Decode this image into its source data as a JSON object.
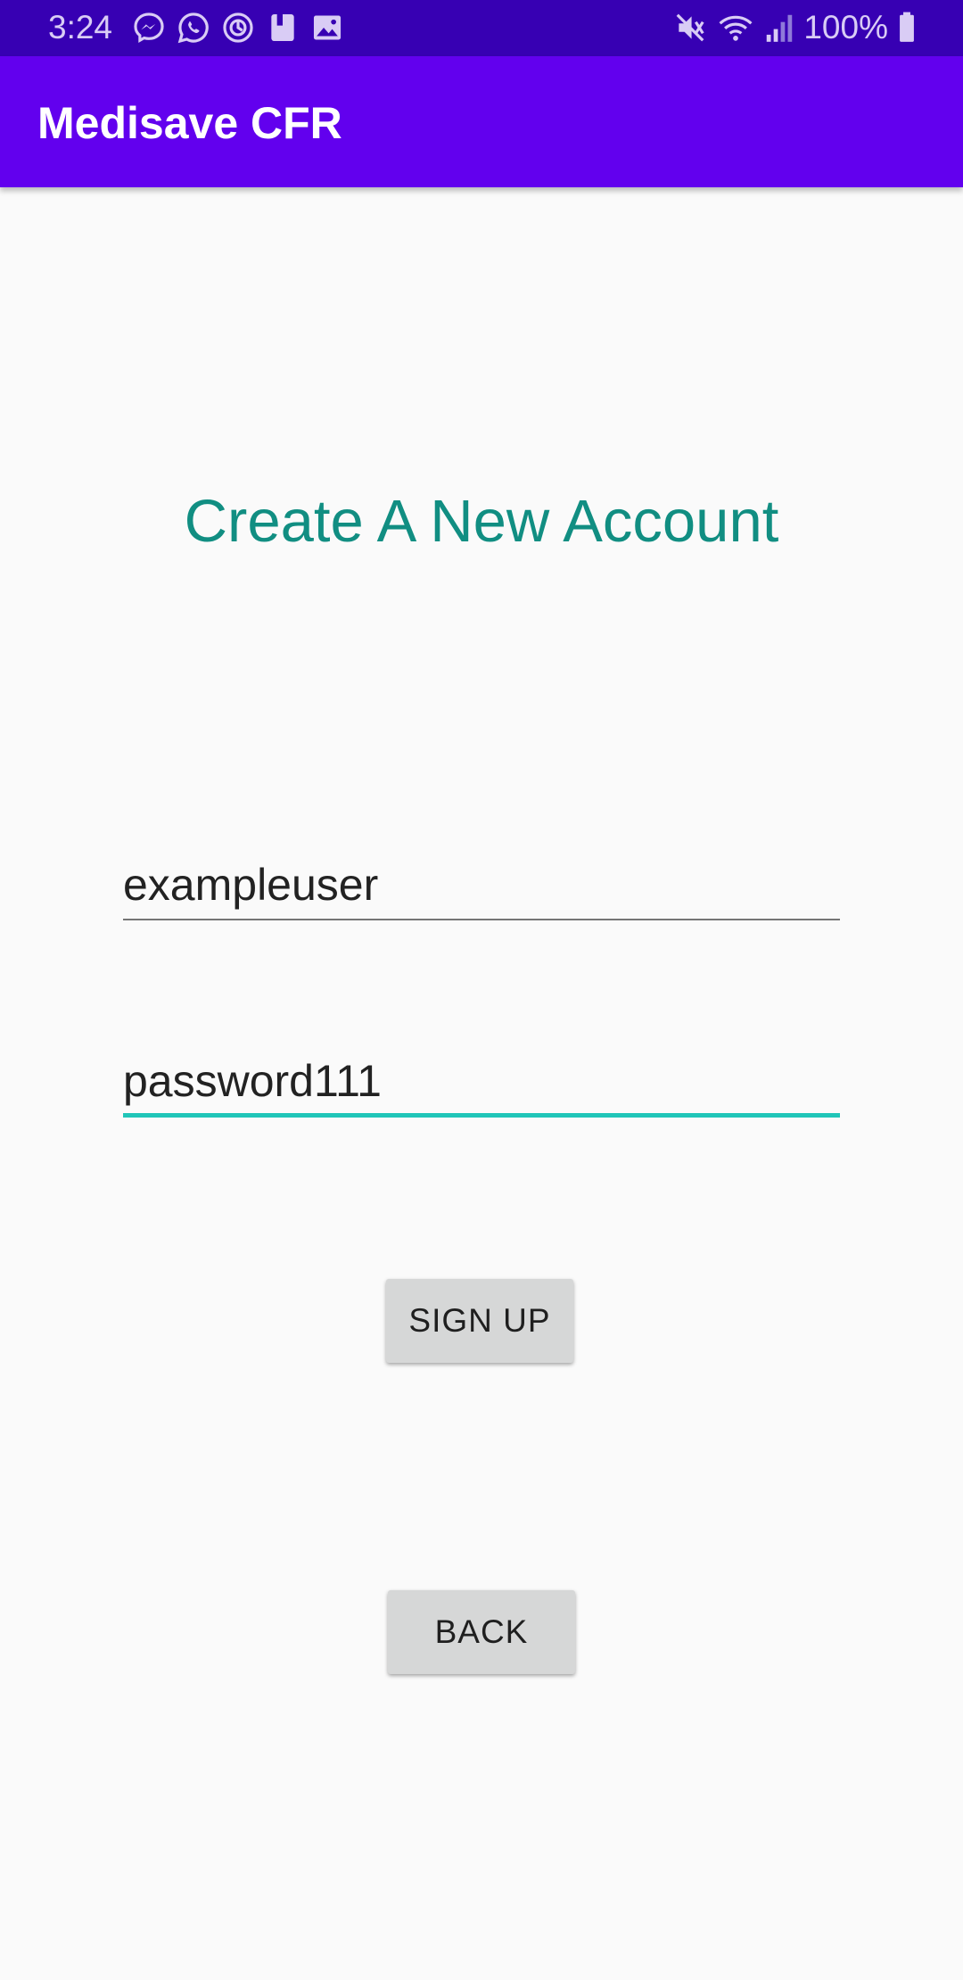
{
  "status_bar": {
    "time": "3:24",
    "left_icons": [
      "messenger-icon",
      "whatsapp-icon",
      "whatsapp-icon",
      "book-icon",
      "image-icon"
    ],
    "right_icons": [
      "mute-icon",
      "wifi-icon",
      "signal-icon",
      "battery-icon"
    ],
    "battery_percent": "100%"
  },
  "app_bar": {
    "title": "Medisave CFR",
    "color": "#6200ee"
  },
  "form": {
    "heading": "Create A New Account",
    "heading_color": "#118e82",
    "username_value": "exampleuser",
    "password_value": "password111",
    "active_field_color": "#20c5b8"
  },
  "buttons": {
    "signup_label": "SIGN UP",
    "back_label": "BACK"
  }
}
